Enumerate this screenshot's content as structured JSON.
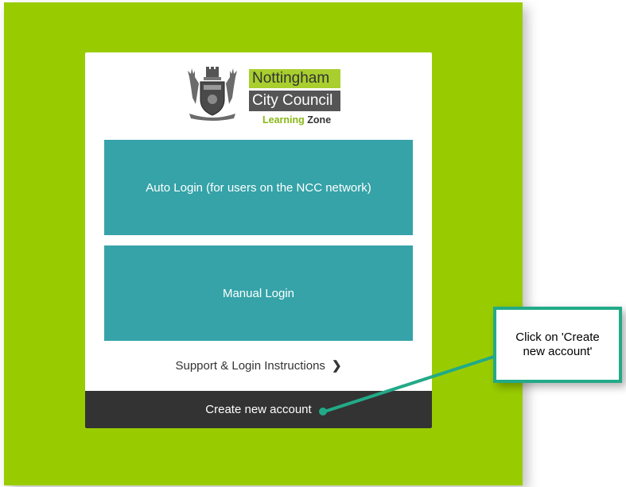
{
  "logo": {
    "line1": "Nottingham",
    "line2": "City Council",
    "line3_accent": "Learning",
    "line3_rest": "Zone"
  },
  "buttons": {
    "auto_login": "Auto Login (for users on the NCC network)",
    "manual_login": "Manual Login",
    "support": "Support & Login Instructions",
    "support_chevron": "❯",
    "create_account": "Create new account"
  },
  "callout": {
    "text": "Click on 'Create new account'"
  },
  "colors": {
    "background_green": "#99cc00",
    "button_teal": "#35a3a8",
    "create_dark": "#333333",
    "callout_border": "#22aa88"
  }
}
